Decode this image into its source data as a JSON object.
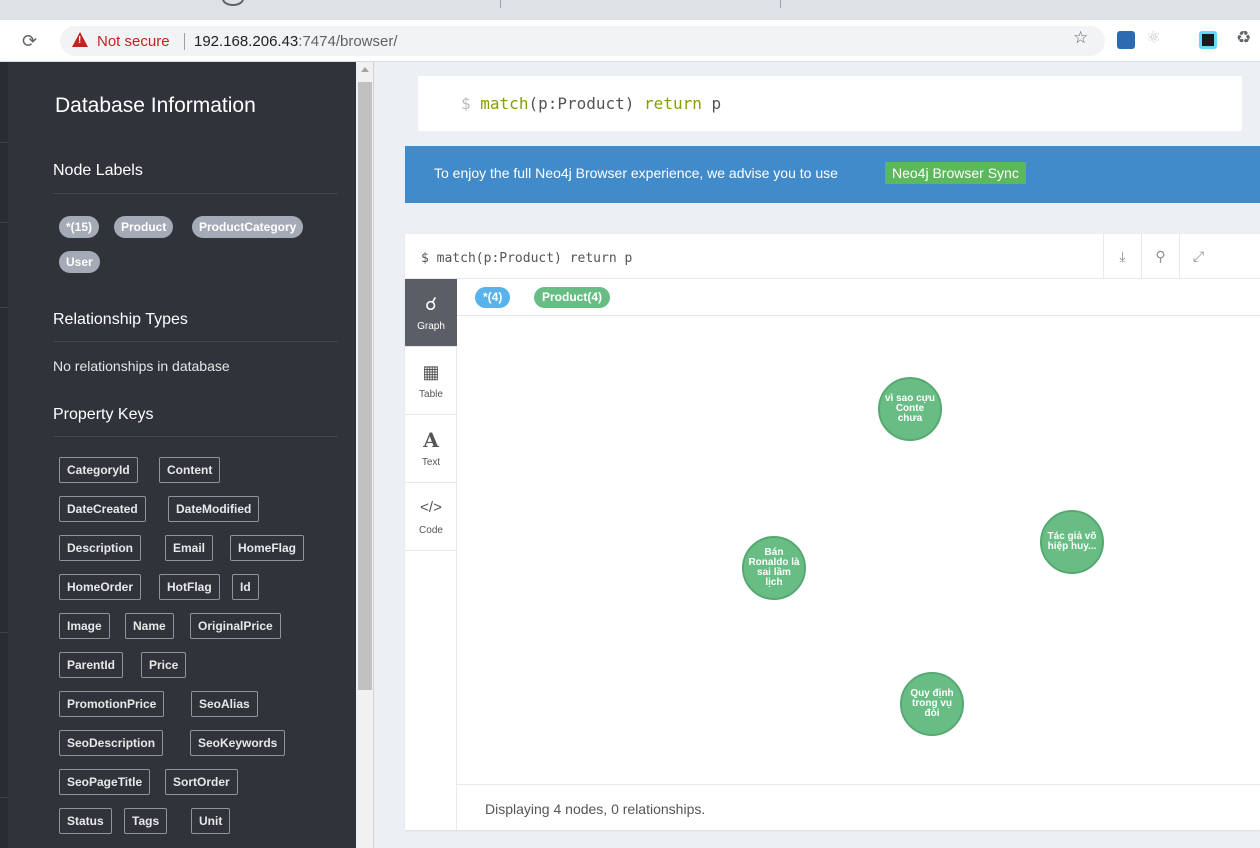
{
  "browser": {
    "reload_icon": "reload-icon",
    "security_label": "Not secure",
    "url_host": "192.168.206.43",
    "url_path": ":7474/browser/"
  },
  "sidebar": {
    "title": "Database Information",
    "node_labels_title": "Node Labels",
    "node_labels": [
      "*(15)",
      "Product",
      "ProductCategory",
      "User"
    ],
    "relationship_types_title": "Relationship Types",
    "no_relationships": "No relationships in database",
    "property_keys_title": "Property Keys",
    "property_keys": [
      "CategoryId",
      "Content",
      "DateCreated",
      "DateModified",
      "Description",
      "Email",
      "HomeFlag",
      "HomeOrder",
      "HotFlag",
      "Id",
      "Image",
      "Name",
      "OriginalPrice",
      "ParentId",
      "Price",
      "PromotionPrice",
      "SeoAlias",
      "SeoDescription",
      "SeoKeywords",
      "SeoPageTitle",
      "SortOrder",
      "Status",
      "Tags",
      "Unit"
    ]
  },
  "editor": {
    "prompt": "$",
    "keyword_match": "match",
    "pattern": "(p:Product) ",
    "keyword_return": "return",
    "tail": " p"
  },
  "banner": {
    "text": "To enjoy the full Neo4j Browser experience, we advise you to use",
    "button": "Neo4j Browser Sync"
  },
  "frame": {
    "command": "$ match(p:Product) return p",
    "tabs": [
      {
        "label": "Graph",
        "icon": "graph-icon"
      },
      {
        "label": "Table",
        "icon": "table-icon"
      },
      {
        "label": "Text",
        "icon": "text-icon"
      },
      {
        "label": "Code",
        "icon": "code-icon"
      }
    ],
    "legend": [
      {
        "label": "*(4)",
        "color": "#58b3ec"
      },
      {
        "label": "Product(4)",
        "color": "#68bd84"
      }
    ],
    "nodes": [
      "vì sao cựu Conte chưa",
      "Bán Ronaldo là sai lầm lịch",
      "Tác giả võ hiệp huy...",
      "Quy định trong vụ đòi"
    ],
    "status": "Displaying 4 nodes, 0 relationships."
  },
  "colors": {
    "sidebar_bg": "#31333b",
    "banner_bg": "#428bca",
    "sync_button": "#5cb85c",
    "node_fill": "#68bd84",
    "label_pill": "#a5abb6"
  }
}
